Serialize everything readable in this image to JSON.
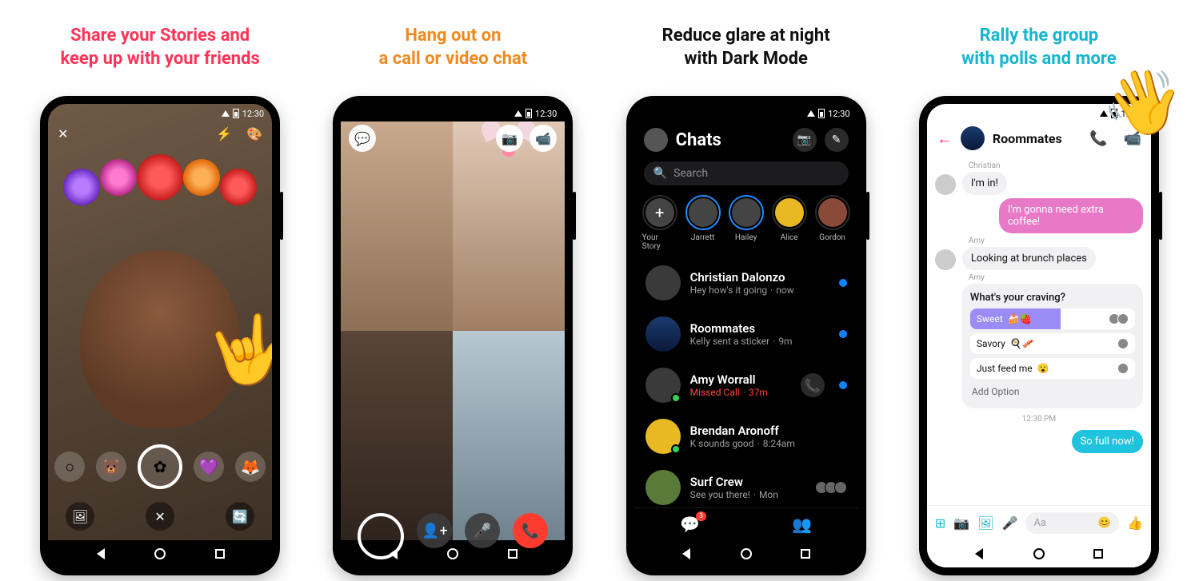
{
  "headlines": {
    "h1a": "Share your Stories and",
    "h1b": "keep up with your friends",
    "h2a": "Hang out on",
    "h2b": "a call or video chat",
    "h3a": "Reduce glare at night",
    "h3b": "with Dark Mode",
    "h4a": "Rally the group",
    "h4b": "with polls and more"
  },
  "status": {
    "time": "12:30",
    "time4": "12:39"
  },
  "s1": {
    "close": "✕",
    "flash": "⚡",
    "palette": "🎨",
    "rock_emoji": "🤟",
    "filters": [
      "○",
      "🐻",
      "✿",
      "💜",
      "🦊"
    ],
    "gallery": "🖼",
    "cancel": "✕",
    "flip": "🔄"
  },
  "s2": {
    "chat": "💬",
    "camera": "📷",
    "video": "📹",
    "add": "👤+",
    "mic": "🎤",
    "end": "📞"
  },
  "s3": {
    "title": "Chats",
    "camera": "📷",
    "edit": "✎",
    "search_placeholder": "Search",
    "search_icon": "🔍",
    "stories": [
      {
        "label": "Your Story",
        "plus": "+"
      },
      {
        "label": "Jarrett"
      },
      {
        "label": "Hailey"
      },
      {
        "label": "Alice"
      },
      {
        "label": "Gordon"
      }
    ],
    "chats": [
      {
        "name": "Christian Dalonzo",
        "sub": "Hey how's it going",
        "time": "now",
        "unread": true
      },
      {
        "name": "Roommates",
        "sub": "Kelly sent a sticker",
        "time": "9m",
        "unread": true
      },
      {
        "name": "Amy Worrall",
        "sub": "Missed Call",
        "time": "37m",
        "missed": true,
        "call": true,
        "unread": true
      },
      {
        "name": "Brendan Aronoff",
        "sub": "K sounds good",
        "time": "8:24am",
        "online": true
      },
      {
        "name": "Surf Crew",
        "sub": "See you there!",
        "time": "Mon",
        "group": true
      }
    ],
    "tabs": {
      "chat": "💬",
      "people": "👥",
      "badge": "3"
    }
  },
  "s4": {
    "back": "←",
    "title": "Roommates",
    "call": "📞",
    "video": "📹",
    "wave": "👋",
    "messages": {
      "n1": "Christian",
      "m1": "I'm in!",
      "m2": "I'm gonna need extra coffee!",
      "n3": "Amy",
      "m3": "Looking at brunch places",
      "n4": "Amy"
    },
    "poll": {
      "q": "What's your craving?",
      "opts": [
        {
          "label": "Sweet",
          "emoji": "🍰🍓",
          "pct": 55,
          "sel": true,
          "votes": 2
        },
        {
          "label": "Savory",
          "emoji": "🍳🥓",
          "pct": 0,
          "votes": 1
        },
        {
          "label": "Just feed me",
          "emoji": "😮",
          "pct": 0,
          "votes": 1
        }
      ],
      "add": "Add Option"
    },
    "ts": "12:30 PM",
    "m5": "So full now!",
    "composer": {
      "apps": "⊞",
      "cam": "📷",
      "img": "🖼",
      "mic": "🎤",
      "placeholder": "Aa",
      "emoji": "😊",
      "like": "👍"
    }
  }
}
